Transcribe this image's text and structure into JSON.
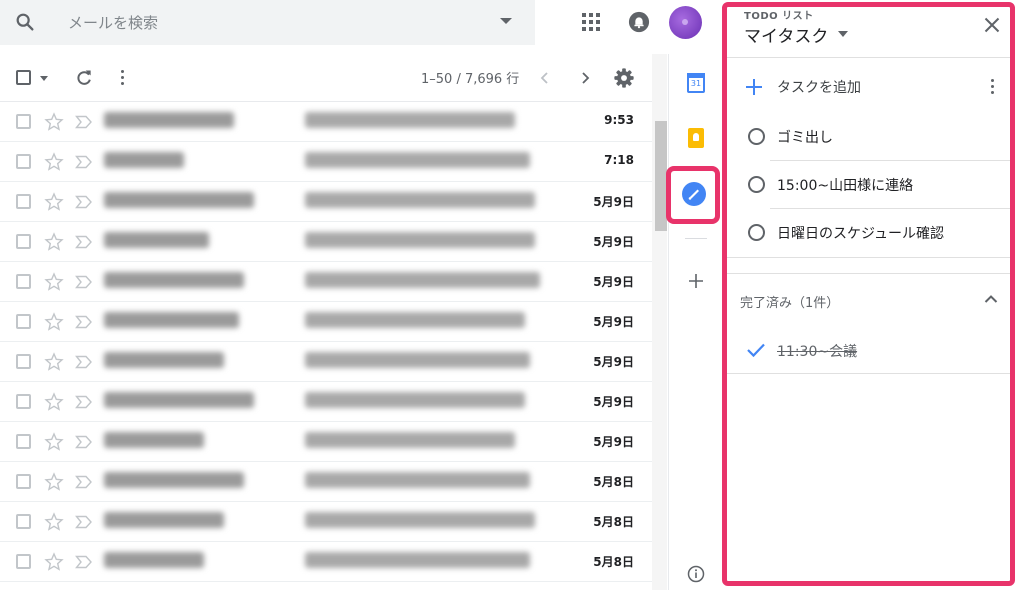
{
  "search": {
    "placeholder": "メールを検索"
  },
  "toolbar": {
    "pager": "1–50 / 7,696 行"
  },
  "rail": {
    "calendar_day": "31"
  },
  "emails": [
    {
      "date": "9:53"
    },
    {
      "date": "7:18"
    },
    {
      "date": "5月9日"
    },
    {
      "date": "5月9日"
    },
    {
      "date": "5月9日"
    },
    {
      "date": "5月9日"
    },
    {
      "date": "5月9日"
    },
    {
      "date": "5月9日"
    },
    {
      "date": "5月9日"
    },
    {
      "date": "5月8日"
    },
    {
      "date": "5月8日"
    },
    {
      "date": "5月8日"
    }
  ],
  "tasks_panel": {
    "label": "TODO リスト",
    "title": "マイタスク",
    "add_label": "タスクを追加",
    "tasks": [
      {
        "title": "ゴミ出し"
      },
      {
        "title": "15:00~山田様に連絡"
      },
      {
        "title": "日曜日のスケジュール確認"
      }
    ],
    "completed_header": "完了済み（1件）",
    "completed": [
      {
        "title": "11:30~会議"
      }
    ]
  },
  "colors": {
    "highlight": "#e8336a",
    "accent": "#4285f4"
  }
}
